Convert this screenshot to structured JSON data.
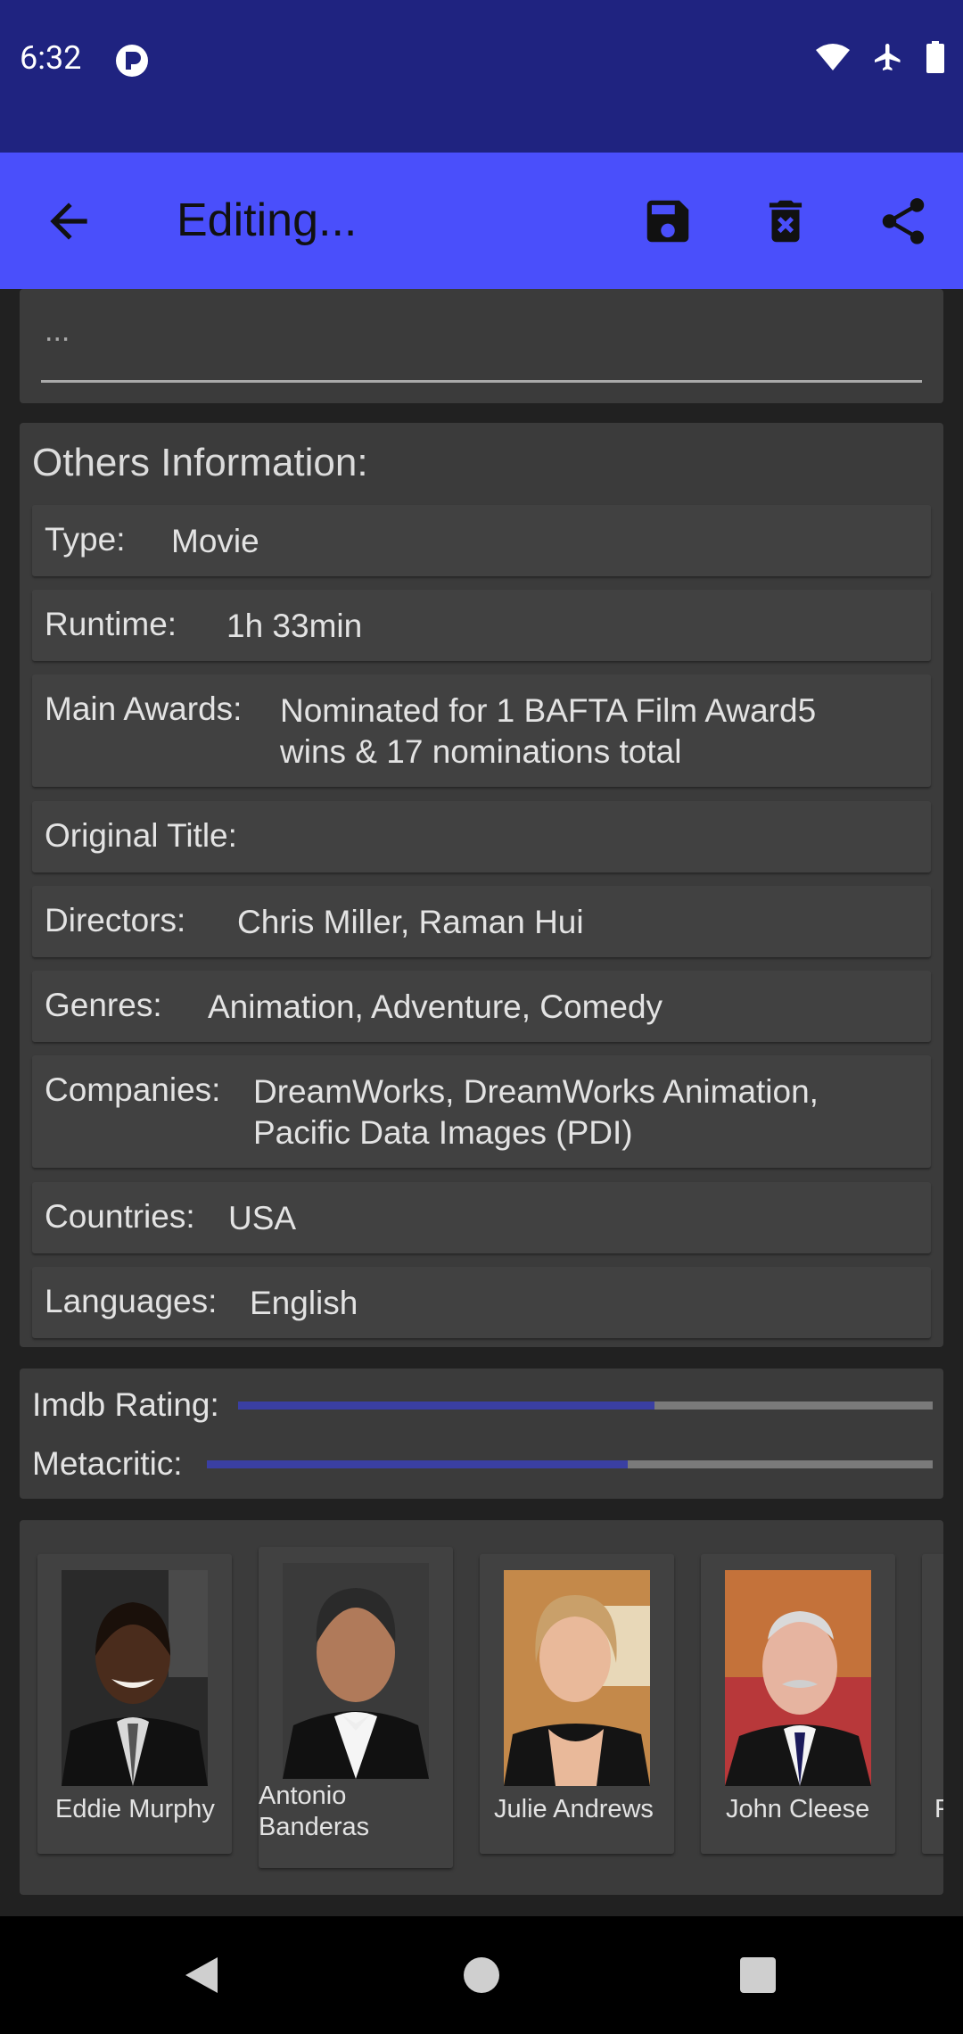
{
  "status_bar": {
    "time": "6:32"
  },
  "app_bar": {
    "title": "Editing...",
    "icons": [
      "back-arrow-icon",
      "save-icon",
      "delete-icon",
      "share-icon"
    ]
  },
  "top_field": {
    "value": "..."
  },
  "others": {
    "heading": "Others Information:",
    "rows": [
      {
        "label": "Type:",
        "value": "Movie"
      },
      {
        "label": "Runtime:",
        "value": "1h 33min"
      },
      {
        "label": "Main Awards:",
        "value_line1": "Nominated for 1 BAFTA Film Award5",
        "value_line2": "wins & 17 nominations total"
      },
      {
        "label": "Original Title:",
        "value": ""
      },
      {
        "label": "Directors:",
        "value": "Chris Miller, Raman Hui"
      },
      {
        "label": "Genres:",
        "value": "Animation, Adventure, Comedy"
      },
      {
        "label": "Companies:",
        "value_line1": "DreamWorks, DreamWorks Animation,",
        "value_line2": "Pacific Data Images (PDI)"
      },
      {
        "label": "Countries:",
        "value": "USA"
      },
      {
        "label": "Languages:",
        "value": "English"
      }
    ]
  },
  "ratings": {
    "imdb_label": "Imdb Rating:",
    "imdb_fraction": 0.6,
    "metacritic_label": "Metacritic:",
    "metacritic_fraction": 0.58
  },
  "cast": [
    {
      "name": "Eddie Murphy"
    },
    {
      "name_line1": "Antonio",
      "name_line2": "Banderas"
    },
    {
      "name": "Julie Andrews"
    },
    {
      "name": "John Cleese"
    },
    {
      "name": "F"
    }
  ],
  "colors": {
    "status_bar": "#1f2380",
    "app_bar": "#4a4ffb",
    "rating_fill": "#3a3fa3"
  }
}
